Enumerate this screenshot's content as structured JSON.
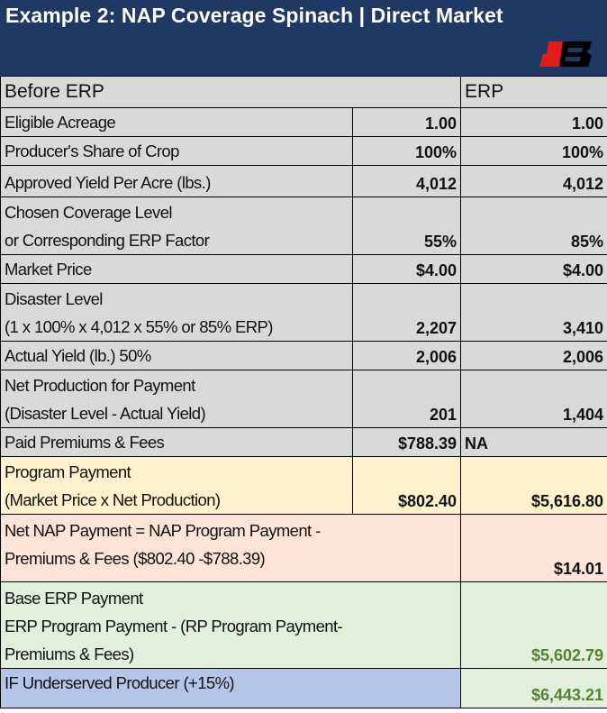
{
  "header": {
    "title": "Example 2: NAP Coverage Spinach  |  Direct Market",
    "logo_icon": "fsa-logo-icon"
  },
  "table": {
    "col_headers": {
      "before": "Before ERP",
      "erp": "ERP"
    },
    "rows": [
      {
        "label_lines": [
          "Eligible Acreage"
        ],
        "before": "1.00",
        "erp": "1.00"
      },
      {
        "label_lines": [
          "Producer's Share of Crop"
        ],
        "before": "100%",
        "erp": "100%"
      },
      {
        "label_lines": [
          "Approved Yield Per Acre (lbs.)"
        ],
        "before": "4,012",
        "erp": "4,012"
      },
      {
        "label_lines": [
          "Chosen Coverage Level",
          "or Corresponding ERP Factor"
        ],
        "before": "55%",
        "erp": "85%"
      },
      {
        "label_lines": [
          "Market Price"
        ],
        "before": "$4.00",
        "erp": "$4.00"
      },
      {
        "label_lines": [
          "Disaster Level",
          "(1 x 100% x 4,012 x 55% or 85% ERP)"
        ],
        "before": "2,207",
        "erp": "3,410"
      },
      {
        "label_lines": [
          "Actual Yield (lb.) 50%"
        ],
        "before": "2,006",
        "erp": "2,006"
      },
      {
        "label_lines": [
          "Net Production for Payment",
          "(Disaster Level - Actual Yield)"
        ],
        "before": "201",
        "erp": "1,404"
      },
      {
        "label_lines": [
          "Paid Premiums & Fees"
        ],
        "before": "$788.39",
        "erp": "NA"
      },
      {
        "label_lines": [
          " Program Payment",
          "(Market Price x Net Production)"
        ],
        "before": "$802.40",
        "erp": "$5,616.80"
      }
    ],
    "net_nap": {
      "label_lines": [
        "Net NAP Payment = NAP Program Payment -",
        "Premiums & Fees ($802.40 -$788.39)"
      ],
      "erp": "$14.01"
    },
    "base_erp": {
      "label_lines": [
        "Base ERP Payment",
        "ERP Program Payment - (RP Program Payment-",
        "Premiums & Fees)"
      ],
      "erp": "$5,602.79"
    },
    "underserved": {
      "label_lines": [
        "IF Underserved Producer (+15%)"
      ],
      "erp": "$6,443.21"
    }
  },
  "colors": {
    "header_bg": "#1f3864",
    "gray": "#d9d9d9",
    "peach": "#fff2cc",
    "salmon": "#fce4d6",
    "green": "#e2efda",
    "blue": "#b4c6e7",
    "green_text": "#548235",
    "logo_red": "#e31d1a"
  }
}
